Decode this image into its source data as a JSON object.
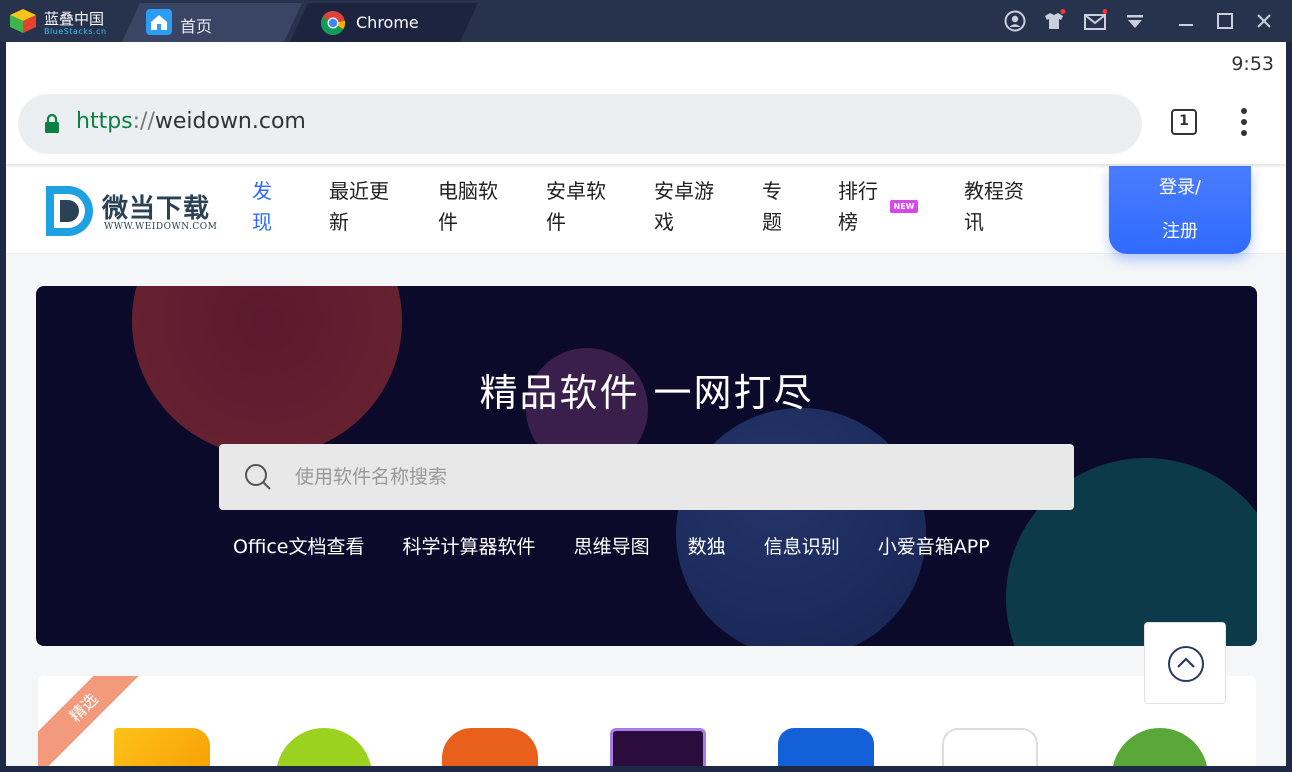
{
  "bluestacks": {
    "app_name": "蓝叠中国",
    "app_sub": "BlueStacks.cn",
    "tabs": [
      {
        "label": "首页"
      },
      {
        "label": "Chrome"
      }
    ]
  },
  "status": {
    "time": "9:53"
  },
  "browser": {
    "url_scheme": "https",
    "url_sep": "://",
    "url_host": "weidown.com",
    "tab_count": "1"
  },
  "site": {
    "logo_cn": "微当下载",
    "logo_en": "WWW.WEIDOWN.COM",
    "nav": [
      {
        "label": "发现"
      },
      {
        "label": "最近更新"
      },
      {
        "label": "电脑软件"
      },
      {
        "label": "安卓软件"
      },
      {
        "label": "安卓游戏"
      },
      {
        "label": "专题"
      },
      {
        "label": "排行榜"
      },
      {
        "label": "教程资讯"
      }
    ],
    "new_badge": "NEW",
    "login_line1": "登录/",
    "login_line2": "注册"
  },
  "hero": {
    "title": "精品软件 一网打尽",
    "search_placeholder": "使用软件名称搜索",
    "hotwords": [
      "Office文档查看",
      "科学计算器软件",
      "思维导图",
      "数独",
      "信息识别",
      "小爱音箱APP"
    ]
  },
  "featured": {
    "ribbon": "精选"
  },
  "colors": {
    "accent": "#2d6df6",
    "hero_bg": "#0c0a2a",
    "titlebar": "#27324d"
  }
}
